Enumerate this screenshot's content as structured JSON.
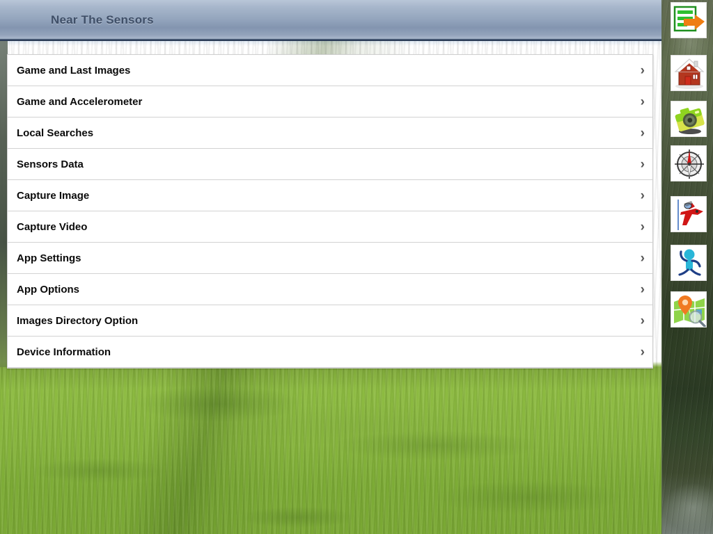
{
  "window": {
    "title": "Near The Sensors"
  },
  "menu": {
    "items": [
      {
        "label": "Game and Last Images",
        "chevron": "›",
        "name": "game-and-last-images"
      },
      {
        "label": "Game and Accelerometer",
        "chevron": "›",
        "name": "game-and-accelerometer"
      },
      {
        "label": "Local Searches",
        "chevron": "›",
        "name": "local-searches"
      },
      {
        "label": "Sensors Data",
        "chevron": "›",
        "name": "sensors-data"
      },
      {
        "label": "Capture Image",
        "chevron": "›",
        "name": "capture-image"
      },
      {
        "label": "Capture Video",
        "chevron": "›",
        "name": "capture-video"
      },
      {
        "label": "App Settings",
        "chevron": "›",
        "name": "app-settings"
      },
      {
        "label": "App Options",
        "chevron": "›",
        "name": "app-options"
      },
      {
        "label": "Images Directory Option",
        "chevron": "›",
        "name": "images-directory-option"
      },
      {
        "label": "Device Information",
        "chevron": "›",
        "name": "device-information"
      }
    ]
  },
  "sidebar": {
    "icons": [
      {
        "name": "back-exit-icon"
      },
      {
        "name": "home-house-icon"
      },
      {
        "name": "camera-icon"
      },
      {
        "name": "compass-icon"
      },
      {
        "name": "airplane-icon"
      },
      {
        "name": "person-motion-icon"
      },
      {
        "name": "map-search-icon"
      }
    ]
  },
  "colors": {
    "titlebar_top": "#b9c6d8",
    "titlebar_bottom": "#8395b0",
    "title_text": "#3f4f68",
    "row_text": "#0b0b0b",
    "row_divider": "#d2d2d2",
    "chevron": "#585858",
    "grass": "#8dbb41",
    "sidebar_dark": "#4f6140"
  }
}
